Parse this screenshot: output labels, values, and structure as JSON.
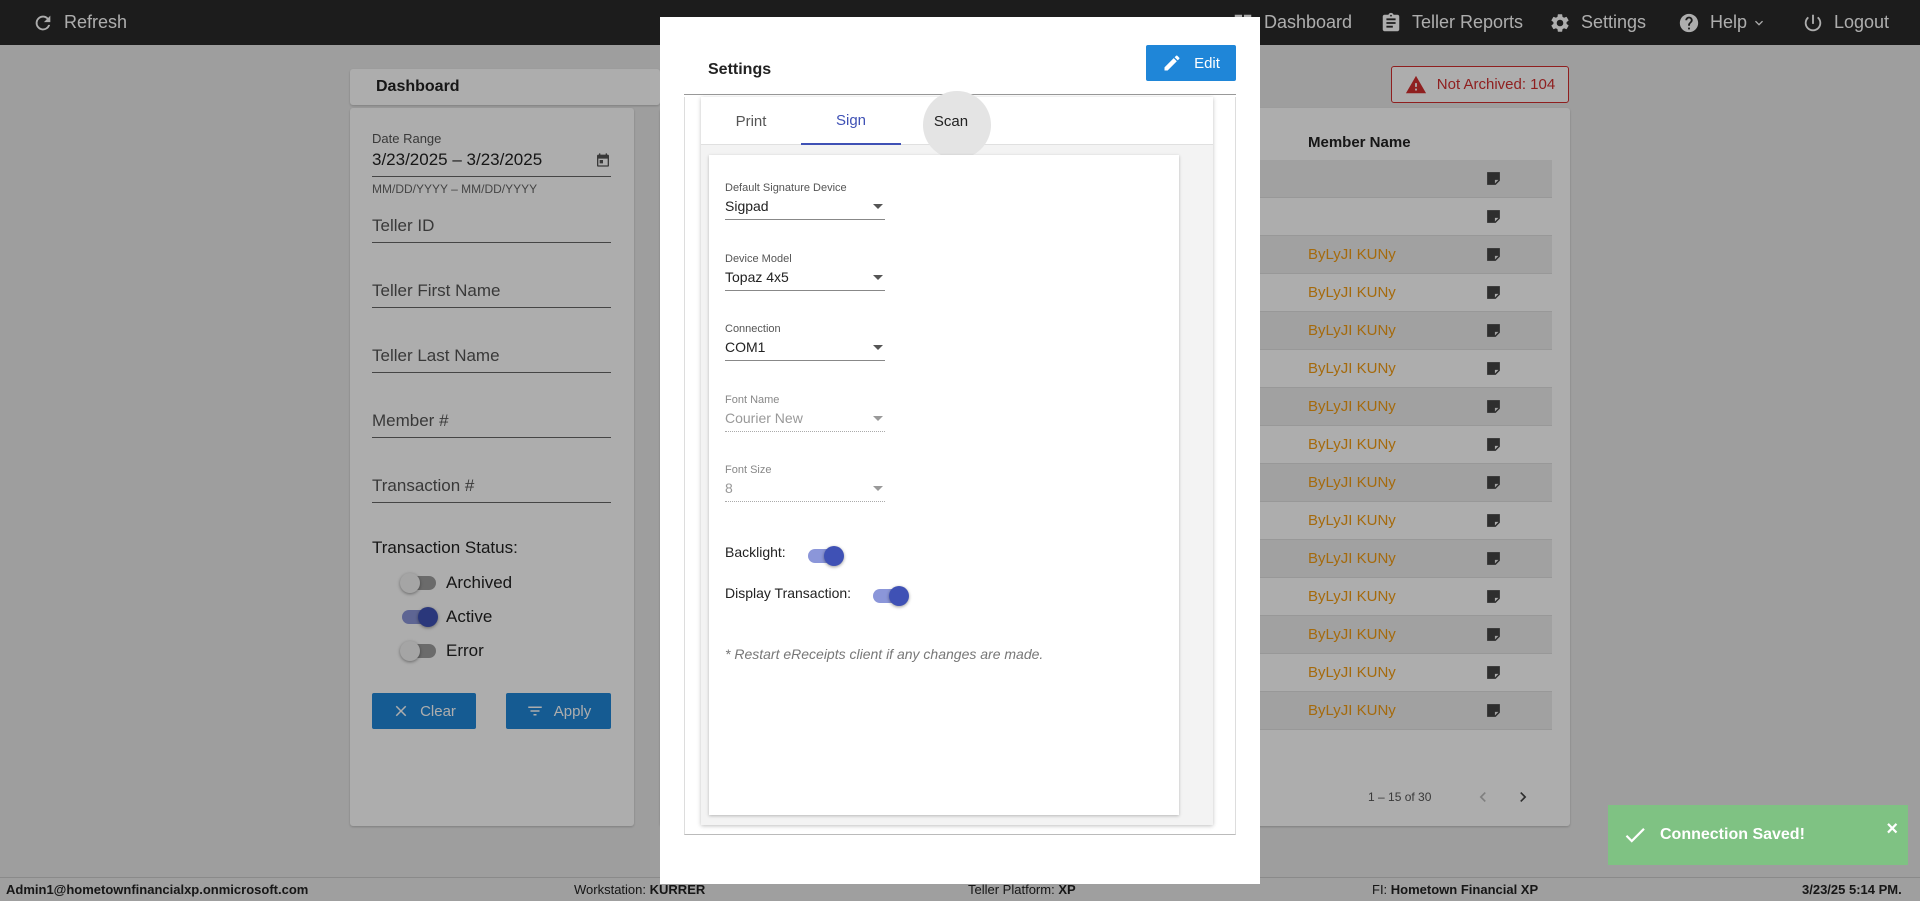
{
  "topbar": {
    "refresh": "Refresh",
    "dashboard": "Dashboard",
    "teller_reports": "Teller Reports",
    "settings": "Settings",
    "help": "Help",
    "logout": "Logout"
  },
  "dashboard": {
    "title": "Dashboard",
    "not_archived": "Not Archived: 104",
    "filters": {
      "date_range_label": "Date Range",
      "date_range_value": "3/23/2025 – 3/23/2025",
      "date_hint": "MM/DD/YYYY – MM/DD/YYYY",
      "teller_id": "Teller ID",
      "teller_first_name": "Teller First Name",
      "teller_last_name": "Teller Last Name",
      "member_number": "Member #",
      "transaction_number": "Transaction #",
      "status_title": "Transaction Status:",
      "statuses": [
        {
          "label": "Archived",
          "on": false
        },
        {
          "label": "Active",
          "on": true
        },
        {
          "label": "Error",
          "on": false
        }
      ],
      "clear": "Clear",
      "apply": "Apply"
    },
    "table": {
      "member_name_header": "Member Name",
      "rows": [
        "",
        "",
        "ByLyJI KUNy",
        "ByLyJI KUNy",
        "ByLyJI KUNy",
        "ByLyJI KUNy",
        "ByLyJI KUNy",
        "ByLyJI KUNy",
        "ByLyJI KUNy",
        "ByLyJI KUNy",
        "ByLyJI KUNy",
        "ByLyJI KUNy",
        "ByLyJI KUNy",
        "ByLyJI KUNy",
        "ByLyJI KUNy"
      ],
      "pager": "1 – 15 of 30"
    }
  },
  "statusbar": {
    "user": "Admin1@hometownfinancialxp.onmicrosoft.com",
    "workstation_label": "Workstation:",
    "workstation_value": "KURRER",
    "platform_label": "Teller Platform:",
    "platform_value": "XP",
    "fi_label": "FI:",
    "fi_value": "Hometown Financial XP",
    "datetime": "3/23/25 5:14 PM."
  },
  "toast": {
    "message": "Connection Saved!",
    "close": "×"
  },
  "modal": {
    "title": "Settings",
    "edit": "Edit",
    "tabs": [
      "Print",
      "Sign",
      "Scan"
    ],
    "active_tab": "Sign",
    "fields": {
      "default_signature_device": {
        "label": "Default Signature Device",
        "value": "Sigpad"
      },
      "device_model": {
        "label": "Device Model",
        "value": "Topaz 4x5"
      },
      "connection": {
        "label": "Connection",
        "value": "COM1"
      },
      "font_name": {
        "label": "Font Name",
        "value": "Courier New"
      },
      "font_size": {
        "label": "Font Size",
        "value": "8"
      }
    },
    "backlight": {
      "label": "Backlight:",
      "on": true
    },
    "display_transaction": {
      "label": "Display Transaction:",
      "on": true
    },
    "note": "* Restart eReceipts client if any changes are made."
  },
  "colors": {
    "accent": "#3f51b5",
    "button_blue": "#1f86d8",
    "warning_red": "#d32f2f",
    "member_name": "#f39c12",
    "toast_green": "#7fc283"
  }
}
